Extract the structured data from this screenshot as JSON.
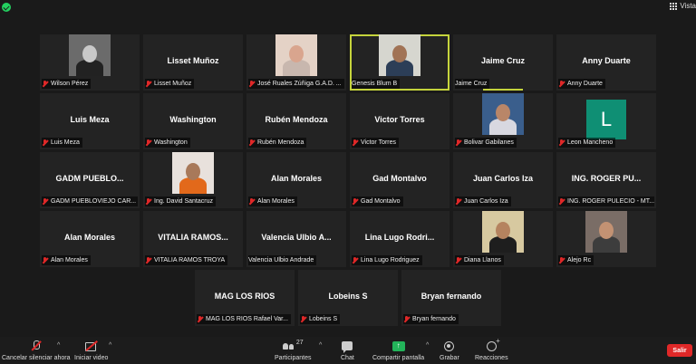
{
  "topbar": {
    "view_label": "Vista"
  },
  "participants": [
    {
      "name": "Wilson Pérez",
      "label": "Wilson Pérez",
      "video": "person-dark",
      "muted": true
    },
    {
      "name": "Lisset Muñoz",
      "label": "Lisset Muñoz",
      "muted": true
    },
    {
      "name": "José Ruales Zúñiga G.A.D.",
      "label": "José Ruales Zúñiga G.A.D. ...",
      "video": "person-mask",
      "muted": true
    },
    {
      "name": "Genesis Blum B",
      "label": "Genesis Blum B",
      "video": "person-speaker",
      "muted": false,
      "active": true
    },
    {
      "name": "Jaime Cruz",
      "label": "Jaime Cruz",
      "muted": false,
      "speaking": true
    },
    {
      "name": "Anny Duarte",
      "label": "Anny Duarte",
      "muted": true
    },
    {
      "name": "Luis Meza",
      "label": "Luis Meza",
      "muted": true
    },
    {
      "name": "Washington",
      "label": "Washington",
      "muted": true
    },
    {
      "name": "Rubén Mendoza",
      "label": "Rubén Mendoza",
      "muted": true
    },
    {
      "name": "Victor Torres",
      "label": "Victor Torres",
      "muted": true
    },
    {
      "name": "Bolivar Gabilanes",
      "label": "Bolivar Gabilanes",
      "video": "person-car",
      "muted": true
    },
    {
      "name": "Leon Mancheno",
      "label": "Leon Mancheno",
      "avatar_letter": "L",
      "muted": true
    },
    {
      "name": "GADM PUEBLO...",
      "label": "GADM PUEBLOVIEJO CAR...",
      "muted": true
    },
    {
      "name": "Ing. David Santacruz",
      "label": "Ing. David Santacruz",
      "video": "person-orange",
      "muted": true
    },
    {
      "name": "Alan Morales",
      "label": "Alan Morales",
      "muted": true
    },
    {
      "name": "Gad Montalvo",
      "label": "Gad Montalvo",
      "muted": true
    },
    {
      "name": "Juan Carlos Iza",
      "label": "Juan Carlos Iza",
      "muted": true
    },
    {
      "name": "ING. ROGER PU...",
      "label": "ING. ROGER PULECIO - MT...",
      "muted": true
    },
    {
      "name": "Alan Morales",
      "label": "Alan Morales",
      "muted": true
    },
    {
      "name": "VITALIA RAMOS...",
      "label": "VITALIA RAMOS TROYA",
      "muted": true
    },
    {
      "name": "Valencia Ulbio A...",
      "label": "Valencia Ulbio Andrade",
      "muted": false
    },
    {
      "name": "Lina Lugo Rodri...",
      "label": "Lina Lugo Rodriguez",
      "muted": true
    },
    {
      "name": "Diana Llanos",
      "label": "Diana Llanos",
      "video": "person-girl",
      "muted": true
    },
    {
      "name": "Alejo Rc",
      "label": "Alejo Rc",
      "video": "person-lying",
      "muted": true
    },
    {
      "name": "MAG LOS RIOS",
      "label": "MAG LOS RIOS Rafael Var...",
      "muted": true
    },
    {
      "name": "Lobeins S",
      "label": "Lobeins S",
      "muted": true
    },
    {
      "name": "Bryan fernando",
      "label": "Bryan fernando",
      "muted": true
    }
  ],
  "toolbar": {
    "unmute_label": "Cancelar silenciar ahora",
    "video_label": "Iniciar video",
    "participants_label": "Participantes",
    "participants_count": "27",
    "chat_label": "Chat",
    "share_label": "Compartir pantalla",
    "record_label": "Grabar",
    "reactions_label": "Reacciones",
    "leave_label": "Salir"
  },
  "colors": {
    "active_border": "#c5d43c",
    "muted_red": "#e02828",
    "share_green": "#23b45a",
    "leave_red": "#e02828",
    "avatar_teal": "#0f8f74"
  }
}
